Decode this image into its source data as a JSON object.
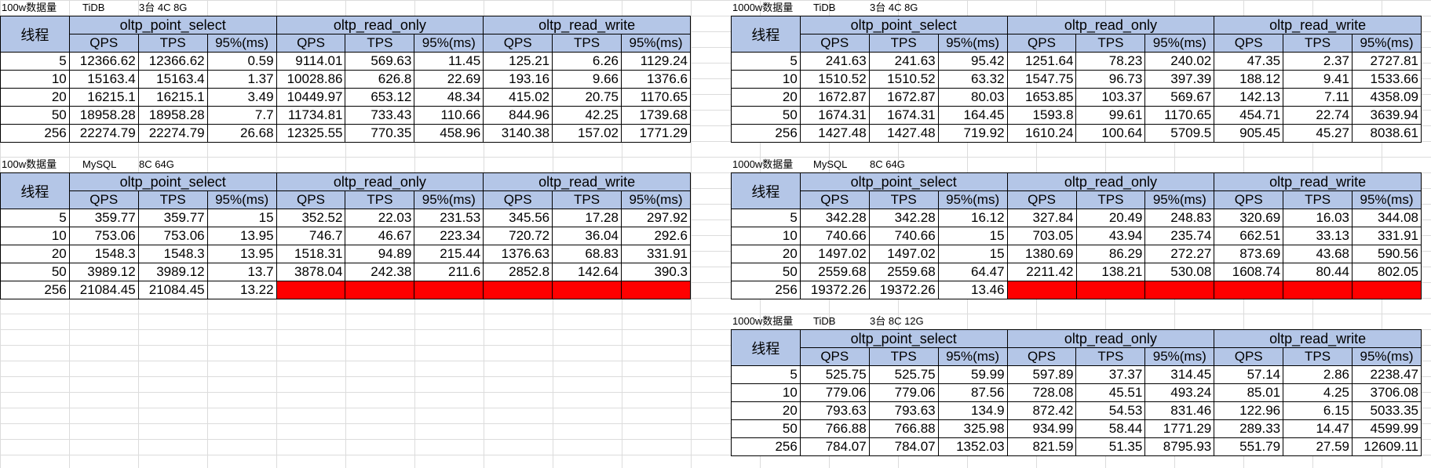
{
  "headers": {
    "thread": "线程",
    "groups": [
      "oltp_point_select",
      "oltp_read_only",
      "oltp_read_write"
    ],
    "metrics": [
      "QPS",
      "TPS",
      "95%(ms)"
    ]
  },
  "tables": [
    {
      "caption": {
        "dataset": "100w数据量",
        "db": "TiDB",
        "spec": "3台 4C 8G"
      },
      "rows": [
        {
          "thread": "5",
          "cells": [
            "12366.62",
            "12366.62",
            "0.59",
            "9114.01",
            "569.63",
            "11.45",
            "125.21",
            "6.26",
            "1129.24"
          ]
        },
        {
          "thread": "10",
          "cells": [
            "15163.4",
            "15163.4",
            "1.37",
            "10028.86",
            "626.8",
            "22.69",
            "193.16",
            "9.66",
            "1376.6"
          ]
        },
        {
          "thread": "20",
          "cells": [
            "16215.1",
            "16215.1",
            "3.49",
            "10449.97",
            "653.12",
            "48.34",
            "415.02",
            "20.75",
            "1170.65"
          ]
        },
        {
          "thread": "50",
          "cells": [
            "18958.28",
            "18958.28",
            "7.7",
            "11734.81",
            "733.43",
            "110.66",
            "844.96",
            "42.25",
            "1739.68"
          ]
        },
        {
          "thread": "256",
          "cells": [
            "22274.79",
            "22274.79",
            "26.68",
            "12325.55",
            "770.35",
            "458.96",
            "3140.38",
            "157.02",
            "1771.29"
          ]
        }
      ]
    },
    {
      "caption": {
        "dataset": "1000w数据量",
        "db": "TiDB",
        "spec": "3台 4C 8G"
      },
      "rows": [
        {
          "thread": "5",
          "cells": [
            "241.63",
            "241.63",
            "95.42",
            "1251.64",
            "78.23",
            "240.02",
            "47.35",
            "2.37",
            "2727.81"
          ]
        },
        {
          "thread": "10",
          "cells": [
            "1510.52",
            "1510.52",
            "63.32",
            "1547.75",
            "96.73",
            "397.39",
            "188.12",
            "9.41",
            "1533.66"
          ]
        },
        {
          "thread": "20",
          "cells": [
            "1672.87",
            "1672.87",
            "80.03",
            "1653.85",
            "103.37",
            "569.67",
            "142.13",
            "7.11",
            "4358.09"
          ]
        },
        {
          "thread": "50",
          "cells": [
            "1674.31",
            "1674.31",
            "164.45",
            "1593.8",
            "99.61",
            "1170.65",
            "454.71",
            "22.74",
            "3639.94"
          ]
        },
        {
          "thread": "256",
          "cells": [
            "1427.48",
            "1427.48",
            "719.92",
            "1610.24",
            "100.64",
            "5709.5",
            "905.45",
            "45.27",
            "8038.61"
          ]
        }
      ]
    },
    {
      "caption": {
        "dataset": "100w数据量",
        "db": "MySQL",
        "spec": "8C 64G"
      },
      "rows": [
        {
          "thread": "5",
          "cells": [
            "359.77",
            "359.77",
            "15",
            "352.52",
            "22.03",
            "231.53",
            "345.56",
            "17.28",
            "297.92"
          ]
        },
        {
          "thread": "10",
          "cells": [
            "753.06",
            "753.06",
            "13.95",
            "746.7",
            "46.67",
            "223.34",
            "720.72",
            "36.04",
            "292.6"
          ]
        },
        {
          "thread": "20",
          "cells": [
            "1548.3",
            "1548.3",
            "13.95",
            "1518.31",
            "94.89",
            "215.44",
            "1376.63",
            "68.83",
            "331.91"
          ]
        },
        {
          "thread": "50",
          "cells": [
            "3989.12",
            "3989.12",
            "13.7",
            "3878.04",
            "242.38",
            "211.6",
            "2852.8",
            "142.64",
            "390.3"
          ]
        },
        {
          "thread": "256",
          "cells": [
            "21084.45",
            "21084.45",
            "13.22",
            "",
            "",
            "",
            "",
            "",
            ""
          ],
          "red_from": 3
        }
      ]
    },
    {
      "caption": {
        "dataset": "1000w数据量",
        "db": "MySQL",
        "spec": "8C 64G"
      },
      "rows": [
        {
          "thread": "5",
          "cells": [
            "342.28",
            "342.28",
            "16.12",
            "327.84",
            "20.49",
            "248.83",
            "320.69",
            "16.03",
            "344.08"
          ]
        },
        {
          "thread": "10",
          "cells": [
            "740.66",
            "740.66",
            "15",
            "703.05",
            "43.94",
            "235.74",
            "662.51",
            "33.13",
            "331.91"
          ]
        },
        {
          "thread": "20",
          "cells": [
            "1497.02",
            "1497.02",
            "15",
            "1380.69",
            "86.29",
            "272.27",
            "873.69",
            "43.68",
            "590.56"
          ]
        },
        {
          "thread": "50",
          "cells": [
            "2559.68",
            "2559.68",
            "64.47",
            "2211.42",
            "138.21",
            "530.08",
            "1608.74",
            "80.44",
            "802.05"
          ]
        },
        {
          "thread": "256",
          "cells": [
            "19372.26",
            "19372.26",
            "13.46",
            "",
            "",
            "",
            "",
            "",
            ""
          ],
          "red_from": 3
        }
      ]
    },
    {
      "caption": {
        "dataset": "1000w数据量",
        "db": "TiDB",
        "spec": "3台 8C 12G"
      },
      "rows": [
        {
          "thread": "5",
          "cells": [
            "525.75",
            "525.75",
            "59.99",
            "597.89",
            "37.37",
            "314.45",
            "57.14",
            "2.86",
            "2238.47"
          ]
        },
        {
          "thread": "10",
          "cells": [
            "779.06",
            "779.06",
            "87.56",
            "728.08",
            "45.51",
            "493.24",
            "85.01",
            "4.25",
            "3706.08"
          ]
        },
        {
          "thread": "20",
          "cells": [
            "793.63",
            "793.63",
            "134.9",
            "872.42",
            "54.53",
            "831.46",
            "122.96",
            "6.15",
            "5033.35"
          ]
        },
        {
          "thread": "50",
          "cells": [
            "766.88",
            "766.88",
            "325.98",
            "934.99",
            "58.44",
            "1771.29",
            "289.33",
            "14.47",
            "4599.99"
          ]
        },
        {
          "thread": "256",
          "cells": [
            "784.07",
            "784.07",
            "1352.03",
            "821.59",
            "51.35",
            "8795.93",
            "551.79",
            "27.59",
            "12609.11"
          ]
        }
      ]
    }
  ],
  "colors": {
    "header_bg": "#b4c6e7",
    "missing_cell": "#ff0000",
    "grid": "#dcdcdc"
  }
}
